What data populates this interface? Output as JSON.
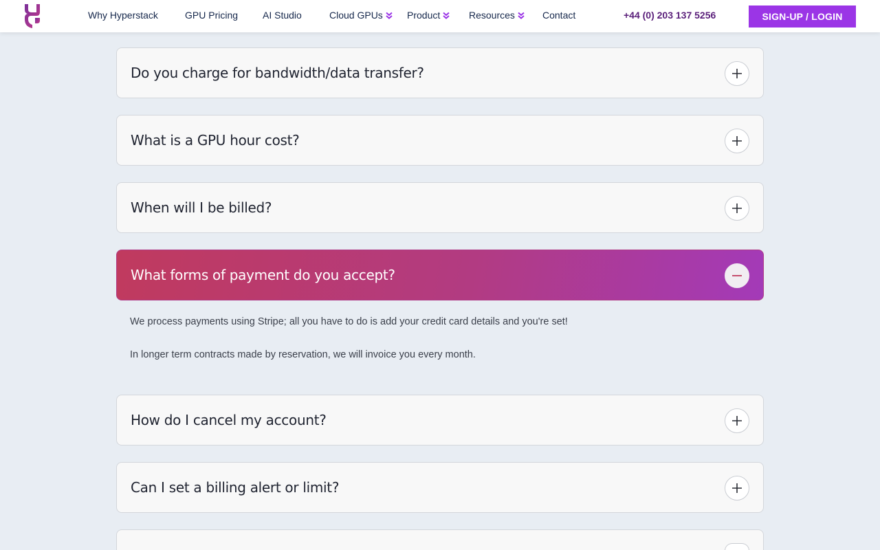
{
  "nav": {
    "items": [
      {
        "label": "Why Hyperstack",
        "has_dropdown": false
      },
      {
        "label": "GPU Pricing",
        "has_dropdown": false
      },
      {
        "label": "AI Studio",
        "has_dropdown": false
      },
      {
        "label": "Cloud GPUs",
        "has_dropdown": true
      },
      {
        "label": "Product",
        "has_dropdown": true
      },
      {
        "label": "Resources",
        "has_dropdown": true
      },
      {
        "label": "Contact",
        "has_dropdown": false
      }
    ],
    "phone": "+44 (0) 203 137 5256",
    "signup_label": "SIGN-UP / LOGIN"
  },
  "colors": {
    "accent": "#9b35e6",
    "nav_text": "#14264a",
    "phone_text": "#5a1f7a",
    "page_bg": "#e8edf3",
    "open_gradient_start": "#c03a5e",
    "open_gradient_end": "#a33ab8"
  },
  "faq": {
    "items": [
      {
        "question": "Do you charge for bandwidth/data transfer?",
        "expanded": false,
        "icon": "plus-icon"
      },
      {
        "question": "What is a GPU hour cost?",
        "expanded": false,
        "icon": "plus-icon"
      },
      {
        "question": "When will I be billed?",
        "expanded": false,
        "icon": "plus-icon"
      },
      {
        "question": "What forms of payment do you accept?",
        "expanded": true,
        "icon": "minus-icon"
      },
      {
        "question": "How do I cancel my account?",
        "expanded": false,
        "icon": "plus-icon"
      },
      {
        "question": "Can I set a billing alert or limit?",
        "expanded": false,
        "icon": "plus-icon"
      },
      {
        "question": "",
        "expanded": false,
        "icon": "plus-icon"
      }
    ],
    "answer": {
      "p1": "We process payments using Stripe; all you have to do is add your credit card details and you're set!",
      "p2": "In longer term contracts made by reservation, we will invoice you every month."
    }
  }
}
